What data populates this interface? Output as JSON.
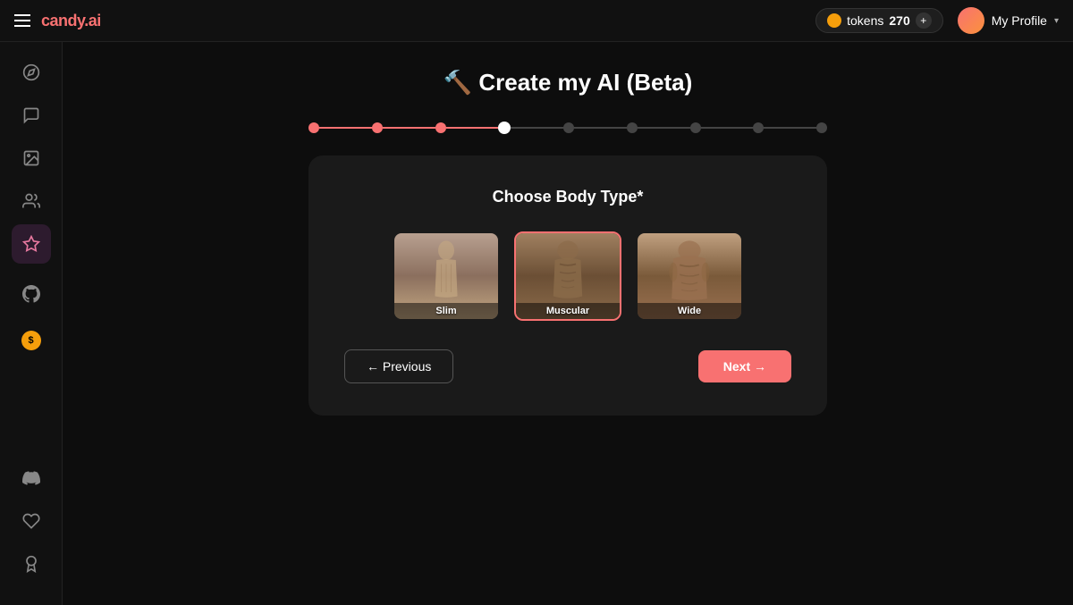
{
  "header": {
    "menu_icon": "☰",
    "logo_text": "candy",
    "logo_suffix": ".ai",
    "tokens_label": "tokens",
    "tokens_count": "270",
    "tokens_add": "+",
    "profile_name": "My Profile",
    "profile_chevron": "▾"
  },
  "sidebar": {
    "top_items": [
      {
        "id": "compass",
        "icon": "◎",
        "label": "Explore"
      },
      {
        "id": "chat",
        "icon": "💬",
        "label": "Chat"
      },
      {
        "id": "gallery",
        "icon": "🖼",
        "label": "Gallery"
      },
      {
        "id": "social",
        "icon": "♻",
        "label": "Social"
      },
      {
        "id": "create",
        "icon": "✦",
        "label": "Create",
        "active": true
      }
    ],
    "mid_items": [
      {
        "id": "github",
        "icon": "⌥",
        "label": "GitHub"
      }
    ],
    "bottom_items": [
      {
        "id": "coin",
        "icon": "🪙",
        "label": "Coins"
      }
    ],
    "extra_bottom": [
      {
        "id": "discord",
        "icon": "⎔",
        "label": "Discord"
      },
      {
        "id": "affiliate",
        "icon": "❤",
        "label": "Affiliate"
      },
      {
        "id": "trophy",
        "icon": "🏆",
        "label": "Leaderboard"
      }
    ]
  },
  "main": {
    "page_title": "🔨 Create my AI (Beta)",
    "progress": {
      "total_steps": 9,
      "current_step": 4,
      "filled_steps": 3
    },
    "card": {
      "title": "Choose Body Type*",
      "body_types": [
        {
          "id": "slim",
          "label": "Slim"
        },
        {
          "id": "muscular",
          "label": "Muscular"
        },
        {
          "id": "wide",
          "label": "Wide"
        }
      ],
      "btn_prev": "← Previous",
      "btn_next": "Next →"
    }
  }
}
